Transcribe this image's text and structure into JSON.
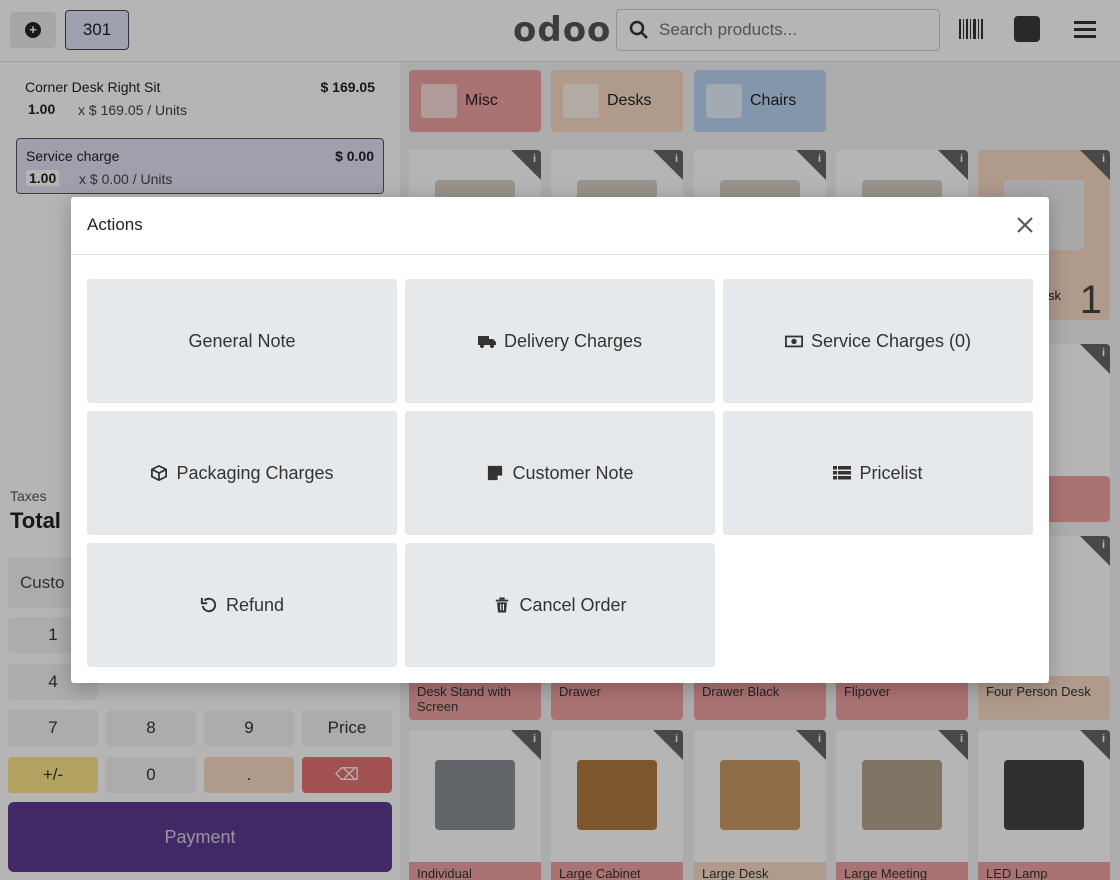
{
  "topbar": {
    "order_number": "301",
    "logo": "odoo",
    "search_placeholder": "Search products..."
  },
  "order": {
    "lines": [
      {
        "name": "Corner Desk Right Sit",
        "price": "$ 169.05",
        "qty": "1.00",
        "unit": "x $ 169.05 / Units"
      },
      {
        "name": "Service charge",
        "price": "$ 0.00",
        "qty": "1.00",
        "unit": "x $ 0.00 / Units"
      }
    ],
    "taxes_label": "Taxes",
    "total_label": "Total"
  },
  "customer_label": "Custo",
  "numpad": {
    "keys": [
      "1",
      "4",
      "7",
      "8",
      "9",
      "Price",
      "+/-",
      "0",
      ".",
      "⌫"
    ]
  },
  "payment_label": "Payment",
  "categories": [
    {
      "label": "Misc",
      "color": "#f0a3a3"
    },
    {
      "label": "Desks",
      "color": "#f7d9c4"
    },
    {
      "label": "Chairs",
      "color": "#b9d4f2"
    }
  ],
  "products_visible": [
    "Desk Stand with Screen",
    "Drawer",
    "Drawer Black",
    "Flipover",
    "Four Person Desk",
    "Individual",
    "Large Cabinet",
    "Large Desk",
    "Large Meeting",
    "LED Lamp"
  ],
  "product_partial_label": "sk",
  "product_partial_qty": "1",
  "modal": {
    "title": "Actions",
    "actions": [
      {
        "label": "General Note",
        "icon": ""
      },
      {
        "label": "Delivery Charges",
        "icon": "truck-icon"
      },
      {
        "label": "Service Charges (0)",
        "icon": "money-icon"
      },
      {
        "label": "Packaging Charges",
        "icon": "box-icon"
      },
      {
        "label": "Customer Note",
        "icon": "sticky-note-icon"
      },
      {
        "label": "Pricelist",
        "icon": "list-icon"
      },
      {
        "label": "Refund",
        "icon": "undo-icon"
      },
      {
        "label": "Cancel Order",
        "icon": "trash-icon"
      }
    ]
  },
  "colors": {
    "accent": "#5b3a8e",
    "misc": "#f0a3a3",
    "desks": "#f7d9c4",
    "chairs": "#b9d4f2",
    "action_bg": "#e6e9ec"
  }
}
